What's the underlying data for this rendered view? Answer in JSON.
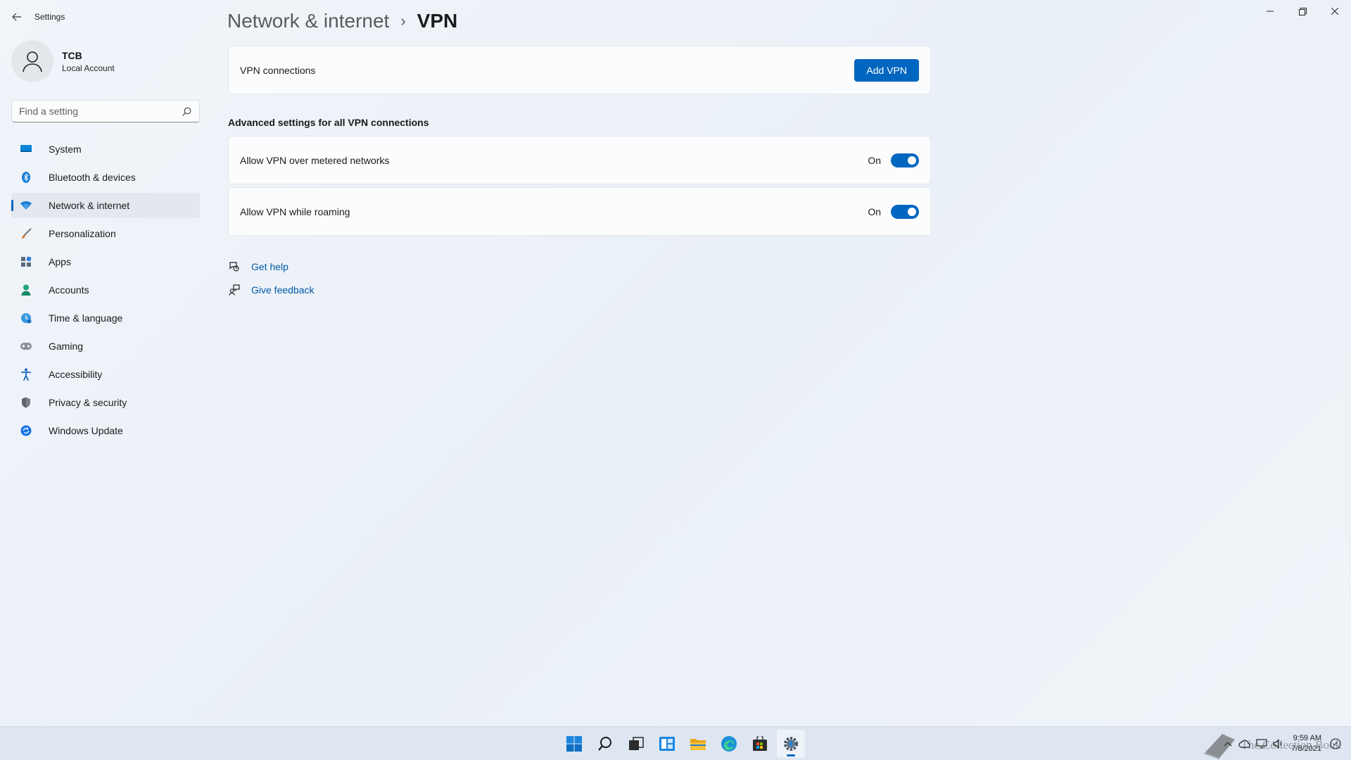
{
  "window": {
    "app_title": "Settings",
    "controls": {
      "minimize": "—",
      "maximize": "❐",
      "close": "✕"
    }
  },
  "profile": {
    "name": "TCB",
    "subtitle": "Local Account"
  },
  "search": {
    "placeholder": "Find a setting",
    "value": ""
  },
  "sidebar": {
    "items": [
      {
        "label": "System",
        "icon": "monitor-icon",
        "color": "#0078d4"
      },
      {
        "label": "Bluetooth & devices",
        "icon": "bluetooth-icon",
        "color": "#0078d4"
      },
      {
        "label": "Network & internet",
        "icon": "wifi-diamond-icon",
        "color": "#0067c0",
        "active": true
      },
      {
        "label": "Personalization",
        "icon": "brush-icon",
        "color": "#c46b1e"
      },
      {
        "label": "Apps",
        "icon": "apps-icon",
        "color": "#3a7bd5"
      },
      {
        "label": "Accounts",
        "icon": "person-icon",
        "color": "#1fa37a"
      },
      {
        "label": "Time & language",
        "icon": "globe-clock-icon",
        "color": "#2a8fd6"
      },
      {
        "label": "Gaming",
        "icon": "gamepad-icon",
        "color": "#7a7a7a"
      },
      {
        "label": "Accessibility",
        "icon": "accessibility-icon",
        "color": "#1565c0"
      },
      {
        "label": "Privacy & security",
        "icon": "shield-icon",
        "color": "#6b6f76"
      },
      {
        "label": "Windows Update",
        "icon": "update-icon",
        "color": "#1a73e8"
      }
    ]
  },
  "breadcrumb": {
    "parent": "Network & internet",
    "separator": "›",
    "current": "VPN"
  },
  "vpn_card": {
    "label": "VPN connections",
    "button": "Add VPN"
  },
  "advanced": {
    "title": "Advanced settings for all VPN connections",
    "toggles": [
      {
        "label": "Allow VPN over metered networks",
        "state": "On",
        "on": true
      },
      {
        "label": "Allow VPN while roaming",
        "state": "On",
        "on": true
      }
    ]
  },
  "links": {
    "help": "Get help",
    "feedback": "Give feedback"
  },
  "taskbar": {
    "apps": [
      "start-icon",
      "search-icon",
      "task-view-icon",
      "widgets-icon",
      "file-explorer-icon",
      "edge-icon",
      "store-icon",
      "settings-icon"
    ],
    "time": "9:59 AM",
    "date": "7/8/2021"
  },
  "watermark": "The Collection Book",
  "colors": {
    "accent": "#0067c0",
    "background": "#eef3f9",
    "card": "#fbfcfd"
  }
}
